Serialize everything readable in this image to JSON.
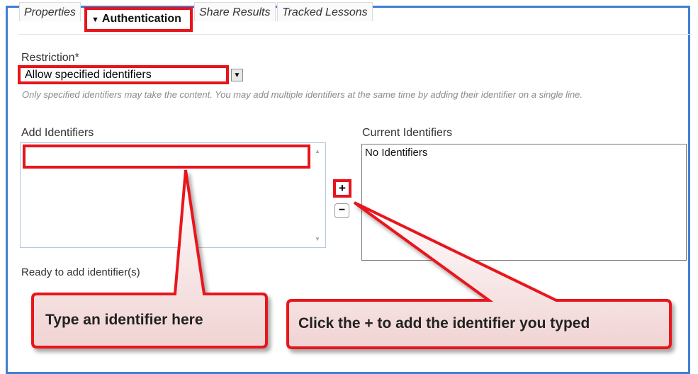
{
  "tabs": {
    "properties": "Properties",
    "authentication": "Authentication",
    "share_results": "Share Results",
    "tracked_lessons": "Tracked Lessons"
  },
  "restriction": {
    "label": "Restriction*",
    "selected": "Allow specified identifiers",
    "help": "Only specified identifiers may take the content. You may add multiple identifiers at the same time by adding their identifier on a single line."
  },
  "add_identifiers": {
    "label": "Add Identifiers",
    "value": "",
    "status": "Ready to add identifier(s)"
  },
  "current_identifiers": {
    "label": "Current Identifiers",
    "empty_text": "No Identifiers"
  },
  "buttons": {
    "add": "+",
    "remove": "−"
  },
  "callouts": {
    "left": "Type an identifier here",
    "right": "Click the + to add the identifier you typed"
  },
  "colors": {
    "frame": "#3f7fd4",
    "highlight": "#e8141b"
  }
}
